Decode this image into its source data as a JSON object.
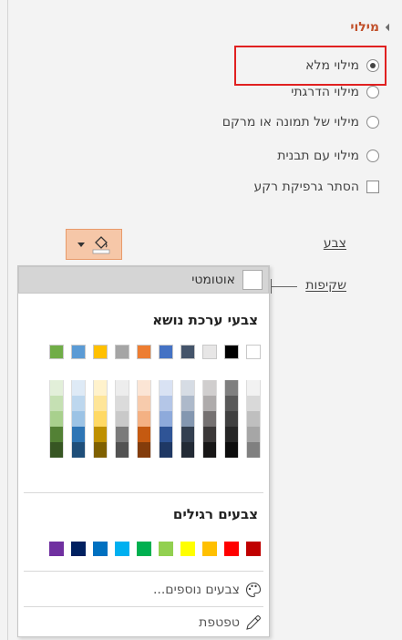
{
  "section": {
    "title": "מילוי"
  },
  "fill_options": [
    {
      "label": "מילוי מלא",
      "checked": true,
      "type": "radio"
    },
    {
      "label": "מילוי הדרגתי",
      "checked": false,
      "type": "radio"
    },
    {
      "label": "מילוי של תמונה או מרקם",
      "checked": false,
      "type": "radio"
    },
    {
      "label": "מילוי עם תבנית",
      "checked": false,
      "type": "radio"
    },
    {
      "label": "הסתר גרפיקת רקע",
      "checked": false,
      "type": "checkbox"
    }
  ],
  "fields": {
    "color_label": "צבע",
    "transparency_label": "שקיפות"
  },
  "dropdown": {
    "automatic_label": "אוטומטי",
    "theme_colors_title": "צבעי ערכת נושא",
    "standard_colors_title": "צבעים רגילים",
    "more_colors_label": "צבעים נוספים...",
    "eyedropper_label": "טפטפת"
  },
  "theme_colors": [
    "#ffffff",
    "#000000",
    "#e7e6e6",
    "#44546a",
    "#4472c4",
    "#ed7d31",
    "#a5a5a5",
    "#ffc000",
    "#5b9bd5",
    "#70ad47"
  ],
  "theme_shades": [
    [
      "#f2f2f2",
      "#d9d9d9",
      "#bfbfbf",
      "#a6a6a6",
      "#808080"
    ],
    [
      "#7f7f7f",
      "#595959",
      "#404040",
      "#262626",
      "#0d0d0d"
    ],
    [
      "#d0cece",
      "#aeabab",
      "#757171",
      "#3b3838",
      "#171616"
    ],
    [
      "#d6dce4",
      "#adb9ca",
      "#8497b0",
      "#333f50",
      "#222a35"
    ],
    [
      "#d9e2f3",
      "#b4c6e7",
      "#8eaadb",
      "#2f5496",
      "#1f3864"
    ],
    [
      "#fbe5d5",
      "#f7cbac",
      "#f4b183",
      "#c55a11",
      "#833c0b"
    ],
    [
      "#ededed",
      "#dbdbdb",
      "#c9c9c9",
      "#7b7b7b",
      "#525252"
    ],
    [
      "#fff2cc",
      "#fee599",
      "#ffd965",
      "#bf9000",
      "#7f6000"
    ],
    [
      "#deeaf6",
      "#bdd7ee",
      "#9cc3e5",
      "#2e75b5",
      "#1f4e79"
    ],
    [
      "#e2efd9",
      "#c5e0b3",
      "#a8d08d",
      "#538135",
      "#375623"
    ]
  ],
  "standard_colors": [
    "#c00000",
    "#ff0000",
    "#ffc000",
    "#ffff00",
    "#92d050",
    "#00b050",
    "#00b0f0",
    "#0070c0",
    "#002060",
    "#7030a0"
  ],
  "accent_colors": {
    "section_title": "#c1502a",
    "highlight_border": "#e02020",
    "color_button": "#f6c7a8"
  },
  "icons": [
    "triangle-expand-icon",
    "paint-bucket-icon",
    "chevron-down-icon",
    "palette-icon",
    "eyedropper-icon"
  ]
}
